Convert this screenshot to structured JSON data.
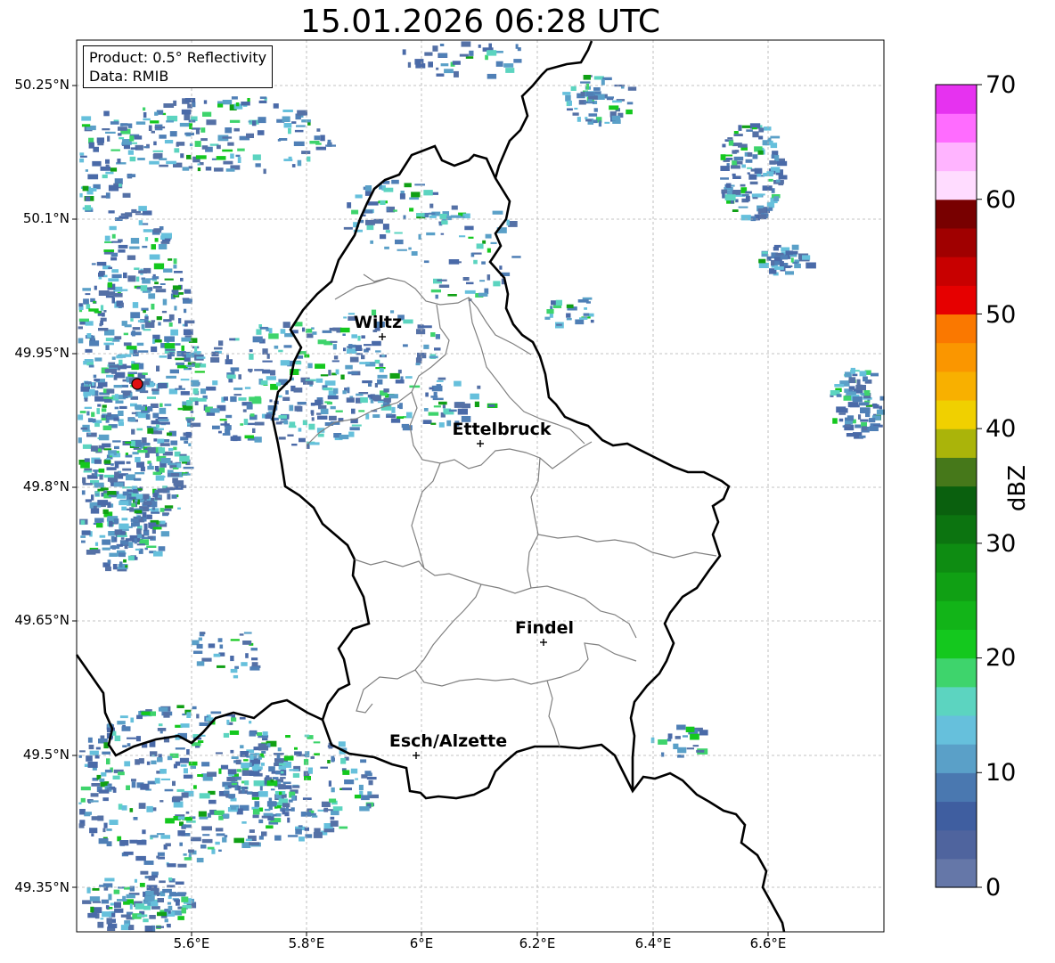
{
  "title": "15.01.2026 06:28 UTC",
  "info": {
    "product": "Product: 0.5° Reflectivity",
    "data": "Data: RMIB"
  },
  "axes": {
    "lat_ticks": [
      "50.25°N",
      "50.1°N",
      "49.95°N",
      "49.8°N",
      "49.65°N",
      "49.5°N",
      "49.35°N"
    ],
    "lon_ticks": [
      "5.6°E",
      "5.8°E",
      "6°E",
      "6.2°E",
      "6.4°E",
      "6.6°E"
    ]
  },
  "cities": [
    {
      "name": "Wiltz"
    },
    {
      "name": "Ettelbruck"
    },
    {
      "name": "Findel"
    },
    {
      "name": "Esch/Alzette"
    }
  ],
  "colorbar": {
    "label": "dBZ",
    "ticks": [
      "0",
      "10",
      "20",
      "30",
      "40",
      "50",
      "60",
      "70"
    ],
    "colors": [
      "#6577a8",
      "#4f649e",
      "#3f5ea0",
      "#4a78b0",
      "#5aa0c8",
      "#66c0dc",
      "#5cd4c0",
      "#3ed46c",
      "#14c81e",
      "#12b418",
      "#10a014",
      "#0e8c12",
      "#0c7410",
      "#0a600e",
      "#46781a",
      "#aab40a",
      "#f0d000",
      "#f8b000",
      "#fa9600",
      "#fa7800",
      "#e60000",
      "#c80000",
      "#a00000",
      "#780000",
      "#ffdcff",
      "#ffb4ff",
      "#ff6cff",
      "#e632f0"
    ]
  },
  "legend_colors": {
    "border": "#000000",
    "district": "#808080",
    "radar": "#e01010"
  }
}
